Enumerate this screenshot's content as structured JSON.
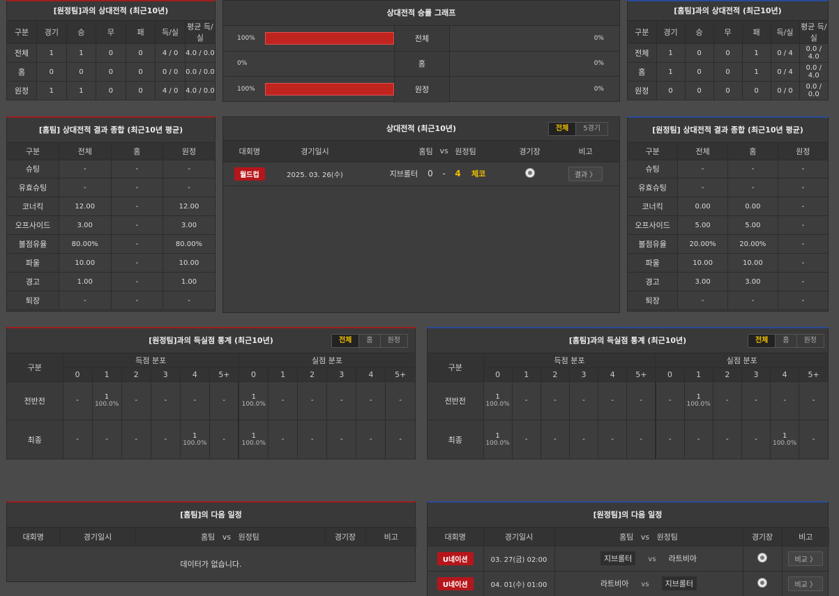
{
  "away_h2h": {
    "title": "[원정팀]과의 상대전적 (최근10년)",
    "headers": [
      "구분",
      "경기",
      "승",
      "무",
      "패",
      "득/실",
      "평균 득/실"
    ],
    "rows": [
      [
        "전체",
        "1",
        "1",
        "0",
        "0",
        "4 / 0",
        "4.0 / 0.0"
      ],
      [
        "홈",
        "0",
        "0",
        "0",
        "0",
        "0 / 0",
        "0.0 / 0.0"
      ],
      [
        "원정",
        "1",
        "1",
        "0",
        "0",
        "4 / 0",
        "4.0 / 0.0"
      ]
    ]
  },
  "graph": {
    "title": "상대전적 승률 그래프",
    "rows": [
      {
        "label": "전체",
        "left": "100%",
        "right": "0%",
        "left_frac": 1.0,
        "right_frac": 0
      },
      {
        "label": "홈",
        "left": "0%",
        "right": "0%",
        "left_frac": 0,
        "right_frac": 0
      },
      {
        "label": "원정",
        "left": "100%",
        "right": "0%",
        "left_frac": 1.0,
        "right_frac": 0
      }
    ]
  },
  "home_h2h": {
    "title": "[홈팀]과의 상대전적 (최근10년)",
    "headers": [
      "구분",
      "경기",
      "승",
      "무",
      "패",
      "득/실",
      "평균 득/실"
    ],
    "rows": [
      [
        "전체",
        "1",
        "0",
        "0",
        "1",
        "0 / 4",
        "0.0 / 4.0"
      ],
      [
        "홈",
        "1",
        "0",
        "0",
        "1",
        "0 / 4",
        "0.0 / 4.0"
      ],
      [
        "원정",
        "0",
        "0",
        "0",
        "0",
        "0 / 0",
        "0.0 / 0.0"
      ]
    ]
  },
  "home_summary": {
    "title": "[홈팀] 상대전적 결과 종합 (최근10년 평균)",
    "headers": [
      "구분",
      "전체",
      "홈",
      "원정"
    ],
    "rows": [
      [
        "슈팅",
        "-",
        "-",
        "-"
      ],
      [
        "유효슈팅",
        "-",
        "-",
        "-"
      ],
      [
        "코너킥",
        "12.00",
        "-",
        "12.00"
      ],
      [
        "오프사이드",
        "3.00",
        "-",
        "3.00"
      ],
      [
        "볼점유율",
        "80.00%",
        "-",
        "80.00%"
      ],
      [
        "파울",
        "10.00",
        "-",
        "10.00"
      ],
      [
        "경고",
        "1.00",
        "-",
        "1.00"
      ],
      [
        "퇴장",
        "-",
        "-",
        "-"
      ]
    ]
  },
  "h2h_list": {
    "title": "상대전적 (최근10년)",
    "tabs": [
      "전체",
      "5경기"
    ],
    "headers": {
      "comp": "대회명",
      "date": "경기일시",
      "home": "홈팀",
      "vs": "vs",
      "away": "원정팀",
      "venue": "경기장",
      "note": "비고"
    },
    "matches": [
      {
        "comp": "월드컵",
        "date": "2025. 03. 26(수)",
        "home": "지브롤터",
        "home_score": "0",
        "sep": "-",
        "away_score": "4",
        "away": "체코",
        "btn": "결과 〉"
      }
    ]
  },
  "away_summary": {
    "title": "[원정팀] 상대전적 결과 종합 (최근10년 평균)",
    "headers": [
      "구분",
      "전체",
      "홈",
      "원정"
    ],
    "rows": [
      [
        "슈팅",
        "-",
        "-",
        "-"
      ],
      [
        "유효슈팅",
        "-",
        "-",
        "-"
      ],
      [
        "코너킥",
        "0.00",
        "0.00",
        "-"
      ],
      [
        "오프사이드",
        "5.00",
        "5.00",
        "-"
      ],
      [
        "볼점유율",
        "20.00%",
        "20.00%",
        "-"
      ],
      [
        "파울",
        "10.00",
        "10.00",
        "-"
      ],
      [
        "경고",
        "3.00",
        "3.00",
        "-"
      ],
      [
        "퇴장",
        "-",
        "-",
        "-"
      ]
    ]
  },
  "away_goals": {
    "title": "[원정팀]과의 득실점 통계 (최근10년)",
    "tabs": [
      "전체",
      "홈",
      "원정"
    ],
    "col_label": "구분",
    "scored_label": "득점 분포",
    "conceded_label": "실점 분포",
    "buckets": [
      "0",
      "1",
      "2",
      "3",
      "4",
      "5+"
    ],
    "rows": [
      {
        "label": "전반전",
        "cells": [
          [
            "-",
            ""
          ],
          [
            "1",
            "100.0%"
          ],
          [
            "-",
            ""
          ],
          [
            "-",
            ""
          ],
          [
            "-",
            ""
          ],
          [
            "-",
            ""
          ],
          [
            "1",
            "100.0%"
          ],
          [
            "-",
            ""
          ],
          [
            "-",
            ""
          ],
          [
            "-",
            ""
          ],
          [
            "-",
            ""
          ],
          [
            "-",
            ""
          ]
        ]
      },
      {
        "label": "최종",
        "cells": [
          [
            "-",
            ""
          ],
          [
            "-",
            ""
          ],
          [
            "-",
            ""
          ],
          [
            "-",
            ""
          ],
          [
            "1",
            "100.0%"
          ],
          [
            "-",
            ""
          ],
          [
            "1",
            "100.0%"
          ],
          [
            "-",
            ""
          ],
          [
            "-",
            ""
          ],
          [
            "-",
            ""
          ],
          [
            "-",
            ""
          ],
          [
            "-",
            ""
          ]
        ]
      }
    ]
  },
  "home_goals": {
    "title": "[홈팀]과의 득실점 통계 (최근10년)",
    "tabs": [
      "전체",
      "홈",
      "원정"
    ],
    "col_label": "구분",
    "scored_label": "득점 분포",
    "conceded_label": "실점 분포",
    "buckets": [
      "0",
      "1",
      "2",
      "3",
      "4",
      "5+"
    ],
    "rows": [
      {
        "label": "전반전",
        "cells": [
          [
            "1",
            "100.0%"
          ],
          [
            "-",
            ""
          ],
          [
            "-",
            ""
          ],
          [
            "-",
            ""
          ],
          [
            "-",
            ""
          ],
          [
            "-",
            ""
          ],
          [
            "-",
            ""
          ],
          [
            "1",
            "100.0%"
          ],
          [
            "-",
            ""
          ],
          [
            "-",
            ""
          ],
          [
            "-",
            ""
          ],
          [
            "-",
            ""
          ]
        ]
      },
      {
        "label": "최종",
        "cells": [
          [
            "1",
            "100.0%"
          ],
          [
            "-",
            ""
          ],
          [
            "-",
            ""
          ],
          [
            "-",
            ""
          ],
          [
            "-",
            ""
          ],
          [
            "-",
            ""
          ],
          [
            "-",
            ""
          ],
          [
            "-",
            ""
          ],
          [
            "-",
            ""
          ],
          [
            "-",
            ""
          ],
          [
            "1",
            "100.0%"
          ],
          [
            "-",
            ""
          ]
        ]
      }
    ]
  },
  "home_next": {
    "title": "[홈팀]의 다음 일정",
    "headers": {
      "comp": "대회명",
      "date": "경기일시",
      "home": "홈팀",
      "vs": "vs",
      "away": "원정팀",
      "venue": "경기장",
      "note": "비고"
    },
    "empty": "데이터가 없습니다."
  },
  "away_next": {
    "title": "[원정팀]의 다음 일정",
    "headers": {
      "comp": "대회명",
      "date": "경기일시",
      "home": "홈팀",
      "vs": "vs",
      "away": "원정팀",
      "venue": "경기장",
      "note": "비고"
    },
    "matches": [
      {
        "comp": "U네이션",
        "date": "03. 27(금) 02:00",
        "home": "지브롤터",
        "vs": "vs",
        "away": "라트비아",
        "highlight": "home",
        "btn": "비교 〉"
      },
      {
        "comp": "U네이션",
        "date": "04. 01(수) 01:00",
        "home": "라트비아",
        "vs": "vs",
        "away": "지브롤터",
        "highlight": "away",
        "btn": "비교 〉"
      }
    ]
  },
  "colors": {
    "accent_red": "#c0241f",
    "accent_gold": "#f0c000",
    "border_red": "#a11d1d",
    "border_blue": "#2a4a9a"
  }
}
